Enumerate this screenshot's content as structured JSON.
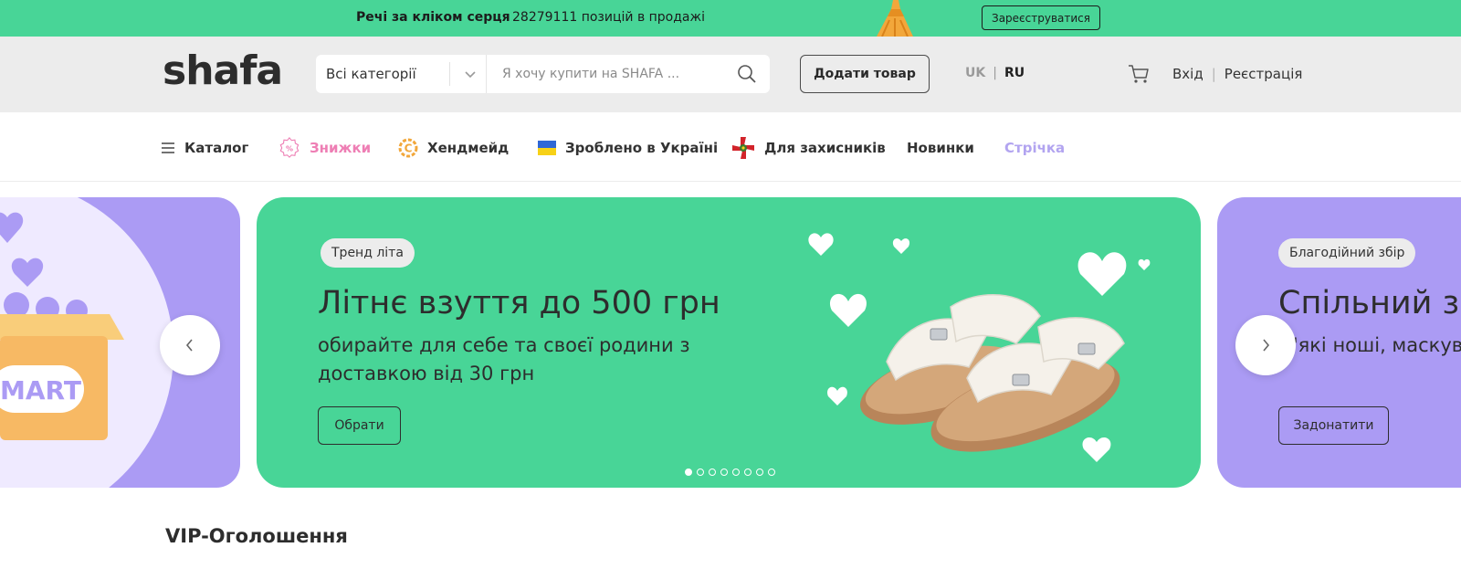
{
  "promo": {
    "title": "Речі за кліком серця",
    "count": "28279111 позицій в продажі",
    "register_label": "Зареєструватися"
  },
  "header": {
    "logo": "shafa",
    "category_select": "Всі категорії",
    "search_placeholder": "Я хочу купити на SHAFA ...",
    "add_product_label": "Додати товар",
    "lang_uk": "UK",
    "lang_sep": "|",
    "lang_ru": "RU",
    "login_label": "Вхід",
    "auth_sep": "|",
    "register_label": "Реєстрація"
  },
  "nav": {
    "catalog": "Каталог",
    "sales": "Знижки",
    "handmade": "Хендмейд",
    "made_in_ukraine": "Зроблено в Україні",
    "defenders": "Для захисників",
    "new": "Новинки",
    "feed": "Стрічка"
  },
  "banner_left": {
    "text": "MART"
  },
  "banner_main": {
    "chip": "Тренд літа",
    "title": "Літнє взуття до 500 грн",
    "subtitle": "обирайте для себе та своєї родини з доставкою від 30 грн",
    "button_label": "Обрати",
    "dots_total": 8,
    "dots_active": 0
  },
  "banner_right": {
    "chip": "Благодійний збір",
    "title": "Спільний з",
    "subtitle": "м'які ноші, маскува",
    "button_label": "Задонатити"
  },
  "section": {
    "vip_title": "VIP-Оголошення"
  },
  "colors": {
    "brand_green": "#48d597",
    "lavender": "#ab9bf4",
    "sales_pink": "#ee7eb4",
    "feed_lilac": "#b2a4f0"
  }
}
